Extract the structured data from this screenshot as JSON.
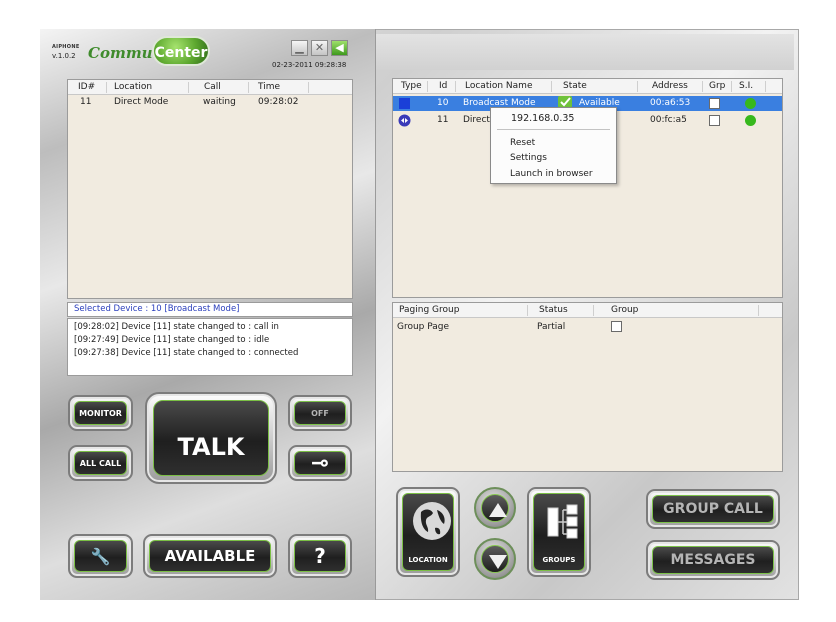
{
  "header": {
    "brand_small": "AIPHONE",
    "version": "v.1.0.2",
    "logo_word": "Communi",
    "logo_badge": "Center",
    "datetime": "02-23-2011 09:28:38",
    "minimize_glyph": "▁",
    "close_glyph": "✕",
    "arrow_glyph": "◀"
  },
  "call_table": {
    "columns": [
      "ID#",
      "Location",
      "Call",
      "Time"
    ],
    "rows": [
      {
        "id": "11",
        "location": "Direct Mode",
        "call": "waiting",
        "time": "09:28:02"
      }
    ]
  },
  "selected_device": "Selected Device : 10  [Broadcast Mode]",
  "log": [
    "[09:28:02] Device [11] state changed to : call in",
    "[09:27:49] Device [11] state changed to : idle",
    "[09:27:38] Device [11] state changed to : connected"
  ],
  "buttons": {
    "monitor": "MONITOR",
    "all_call": "ALL CALL",
    "talk": "TALK",
    "off": "OFF",
    "key_glyph": "⊸",
    "wrench_glyph": "🔧",
    "available": "AVAILABLE",
    "help": "?",
    "location": "LOCATION",
    "groups": "GROUPS",
    "group_call": "GROUP CALL",
    "messages": "MESSAGES"
  },
  "device_table": {
    "columns": [
      "Type",
      "Id",
      "Location Name",
      "State",
      "Address",
      "Grp",
      "S.I."
    ],
    "rows": [
      {
        "id": "10",
        "name": "Broadcast Mode",
        "state": "Available",
        "address": "00:a6:53",
        "selected": true,
        "type_color": "#1a3fd8",
        "si_color": "#37b81d"
      },
      {
        "id": "11",
        "name": "Direct",
        "state": "",
        "address": "00:fc:a5",
        "selected": false,
        "type_color": "#3a3ab8",
        "si_color": "#37b81d"
      }
    ]
  },
  "context_menu": {
    "ip": "192.168.0.35",
    "items": [
      "Reset",
      "Settings",
      "Launch in browser"
    ]
  },
  "paging_table": {
    "columns": [
      "Paging Group",
      "Status",
      "Group"
    ],
    "rows": [
      {
        "name": "Group Page",
        "status": "Partial"
      }
    ]
  },
  "colors": {
    "accent_green": "#7bbf45",
    "selection_blue": "#3a7fe0",
    "panel_bg": "#f1ebe0"
  }
}
